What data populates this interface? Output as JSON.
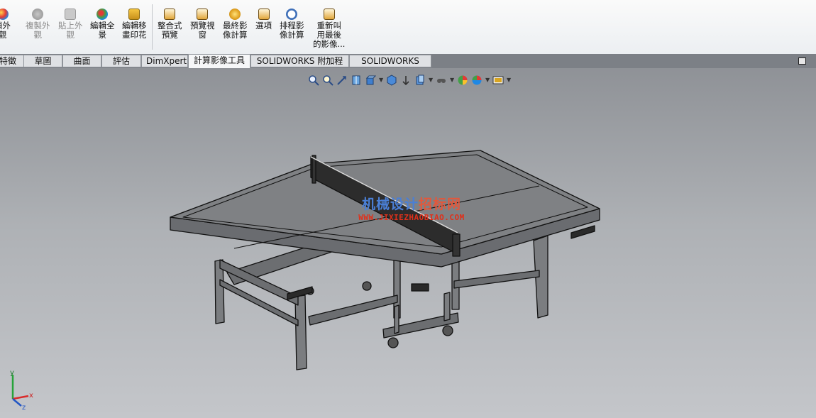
{
  "ribbon": {
    "buttons": [
      {
        "label": "鎖外\n觀",
        "dim": false,
        "color": "#d9534f"
      },
      {
        "label": "複製外\n觀",
        "dim": true,
        "color": "#9a9a9a"
      },
      {
        "label": "貼上外\n觀",
        "dim": true,
        "color": "#a8a8a8"
      },
      {
        "label": "編輯全\n景",
        "dim": false,
        "color": "#3b8a3e"
      },
      {
        "label": "編輯移\n畫印花",
        "dim": false,
        "color": "#d9a520"
      },
      {
        "label": "整合式\n預覽",
        "dim": false,
        "color": "#d98b2b"
      },
      {
        "label": "預覽視\n窗",
        "dim": false,
        "color": "#d98b2b"
      },
      {
        "label": "最終影\n像計算",
        "dim": false,
        "color": "#e0a020"
      },
      {
        "label": "選項",
        "dim": false,
        "color": "#d98b2b"
      },
      {
        "label": "排程影\n像計算",
        "dim": false,
        "color": "#3e6fb8"
      },
      {
        "label": "重新叫\n用最後\n的影像...",
        "dim": false,
        "color": "#d98b2b"
      }
    ]
  },
  "tabs": [
    {
      "label": "特徵",
      "active": false
    },
    {
      "label": "草圖",
      "active": false
    },
    {
      "label": "曲面",
      "active": false
    },
    {
      "label": "評估",
      "active": false
    },
    {
      "label": "DimXpert",
      "active": false
    },
    {
      "label": "計算影像工具",
      "active": true
    },
    {
      "label": "SOLIDWORKS 附加程式",
      "active": false
    },
    {
      "label": "SOLIDWORKS MBD",
      "active": false
    }
  ],
  "hud": {
    "icons": [
      "zoom-to-fit-icon",
      "zoom-to-area-icon",
      "previous-view-icon",
      "section-view-icon",
      "view-orientation-icon",
      "display-style-icon",
      "hide-show-icon",
      "edit-appearance-icon",
      "apply-scene-icon",
      "view-settings-icon"
    ]
  },
  "watermark": {
    "title_a": "机械设计",
    "title_b": "招标网",
    "url": "WWW.JIXIEZHAOBIAO.COM"
  },
  "triad": {
    "x": "x",
    "y": "y",
    "z": "z"
  },
  "colors": {
    "ribbon_bg": "#f3f4f6",
    "tabbar_bg": "#7c8086",
    "viewport_top": "#8f9297",
    "viewport_bottom": "#c4c6ca",
    "model_fill": "#7b7d80",
    "model_line": "#111111"
  }
}
